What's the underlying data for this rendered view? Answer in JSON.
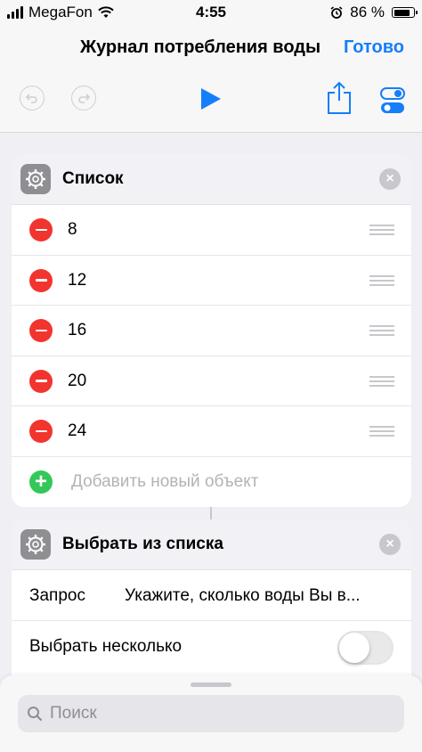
{
  "status_bar": {
    "carrier": "MegaFon",
    "time": "4:55",
    "battery_percent": "86 %",
    "battery_level": 0.86
  },
  "nav": {
    "title": "Журнал потребления воды",
    "done_label": "Готово"
  },
  "icons": {
    "undo": "undo-icon",
    "redo": "redo-icon",
    "play": "play-icon",
    "share": "share-icon",
    "settings": "toggle-settings-icon"
  },
  "colors": {
    "accent": "#157efb",
    "delete": "#f2342f",
    "add": "#34c759"
  },
  "list_card": {
    "title": "Список",
    "items": [
      {
        "value": "8"
      },
      {
        "value": "12"
      },
      {
        "value": "16"
      },
      {
        "value": "20"
      },
      {
        "value": "24"
      }
    ],
    "add_placeholder": "Добавить новый объект"
  },
  "choose_card": {
    "title": "Выбрать из списка",
    "prompt_label": "Запрос",
    "prompt_value": "Укажите, сколько воды Вы в...",
    "multiple_label": "Выбрать несколько",
    "multiple_on": false
  },
  "search": {
    "placeholder": "Поиск"
  }
}
